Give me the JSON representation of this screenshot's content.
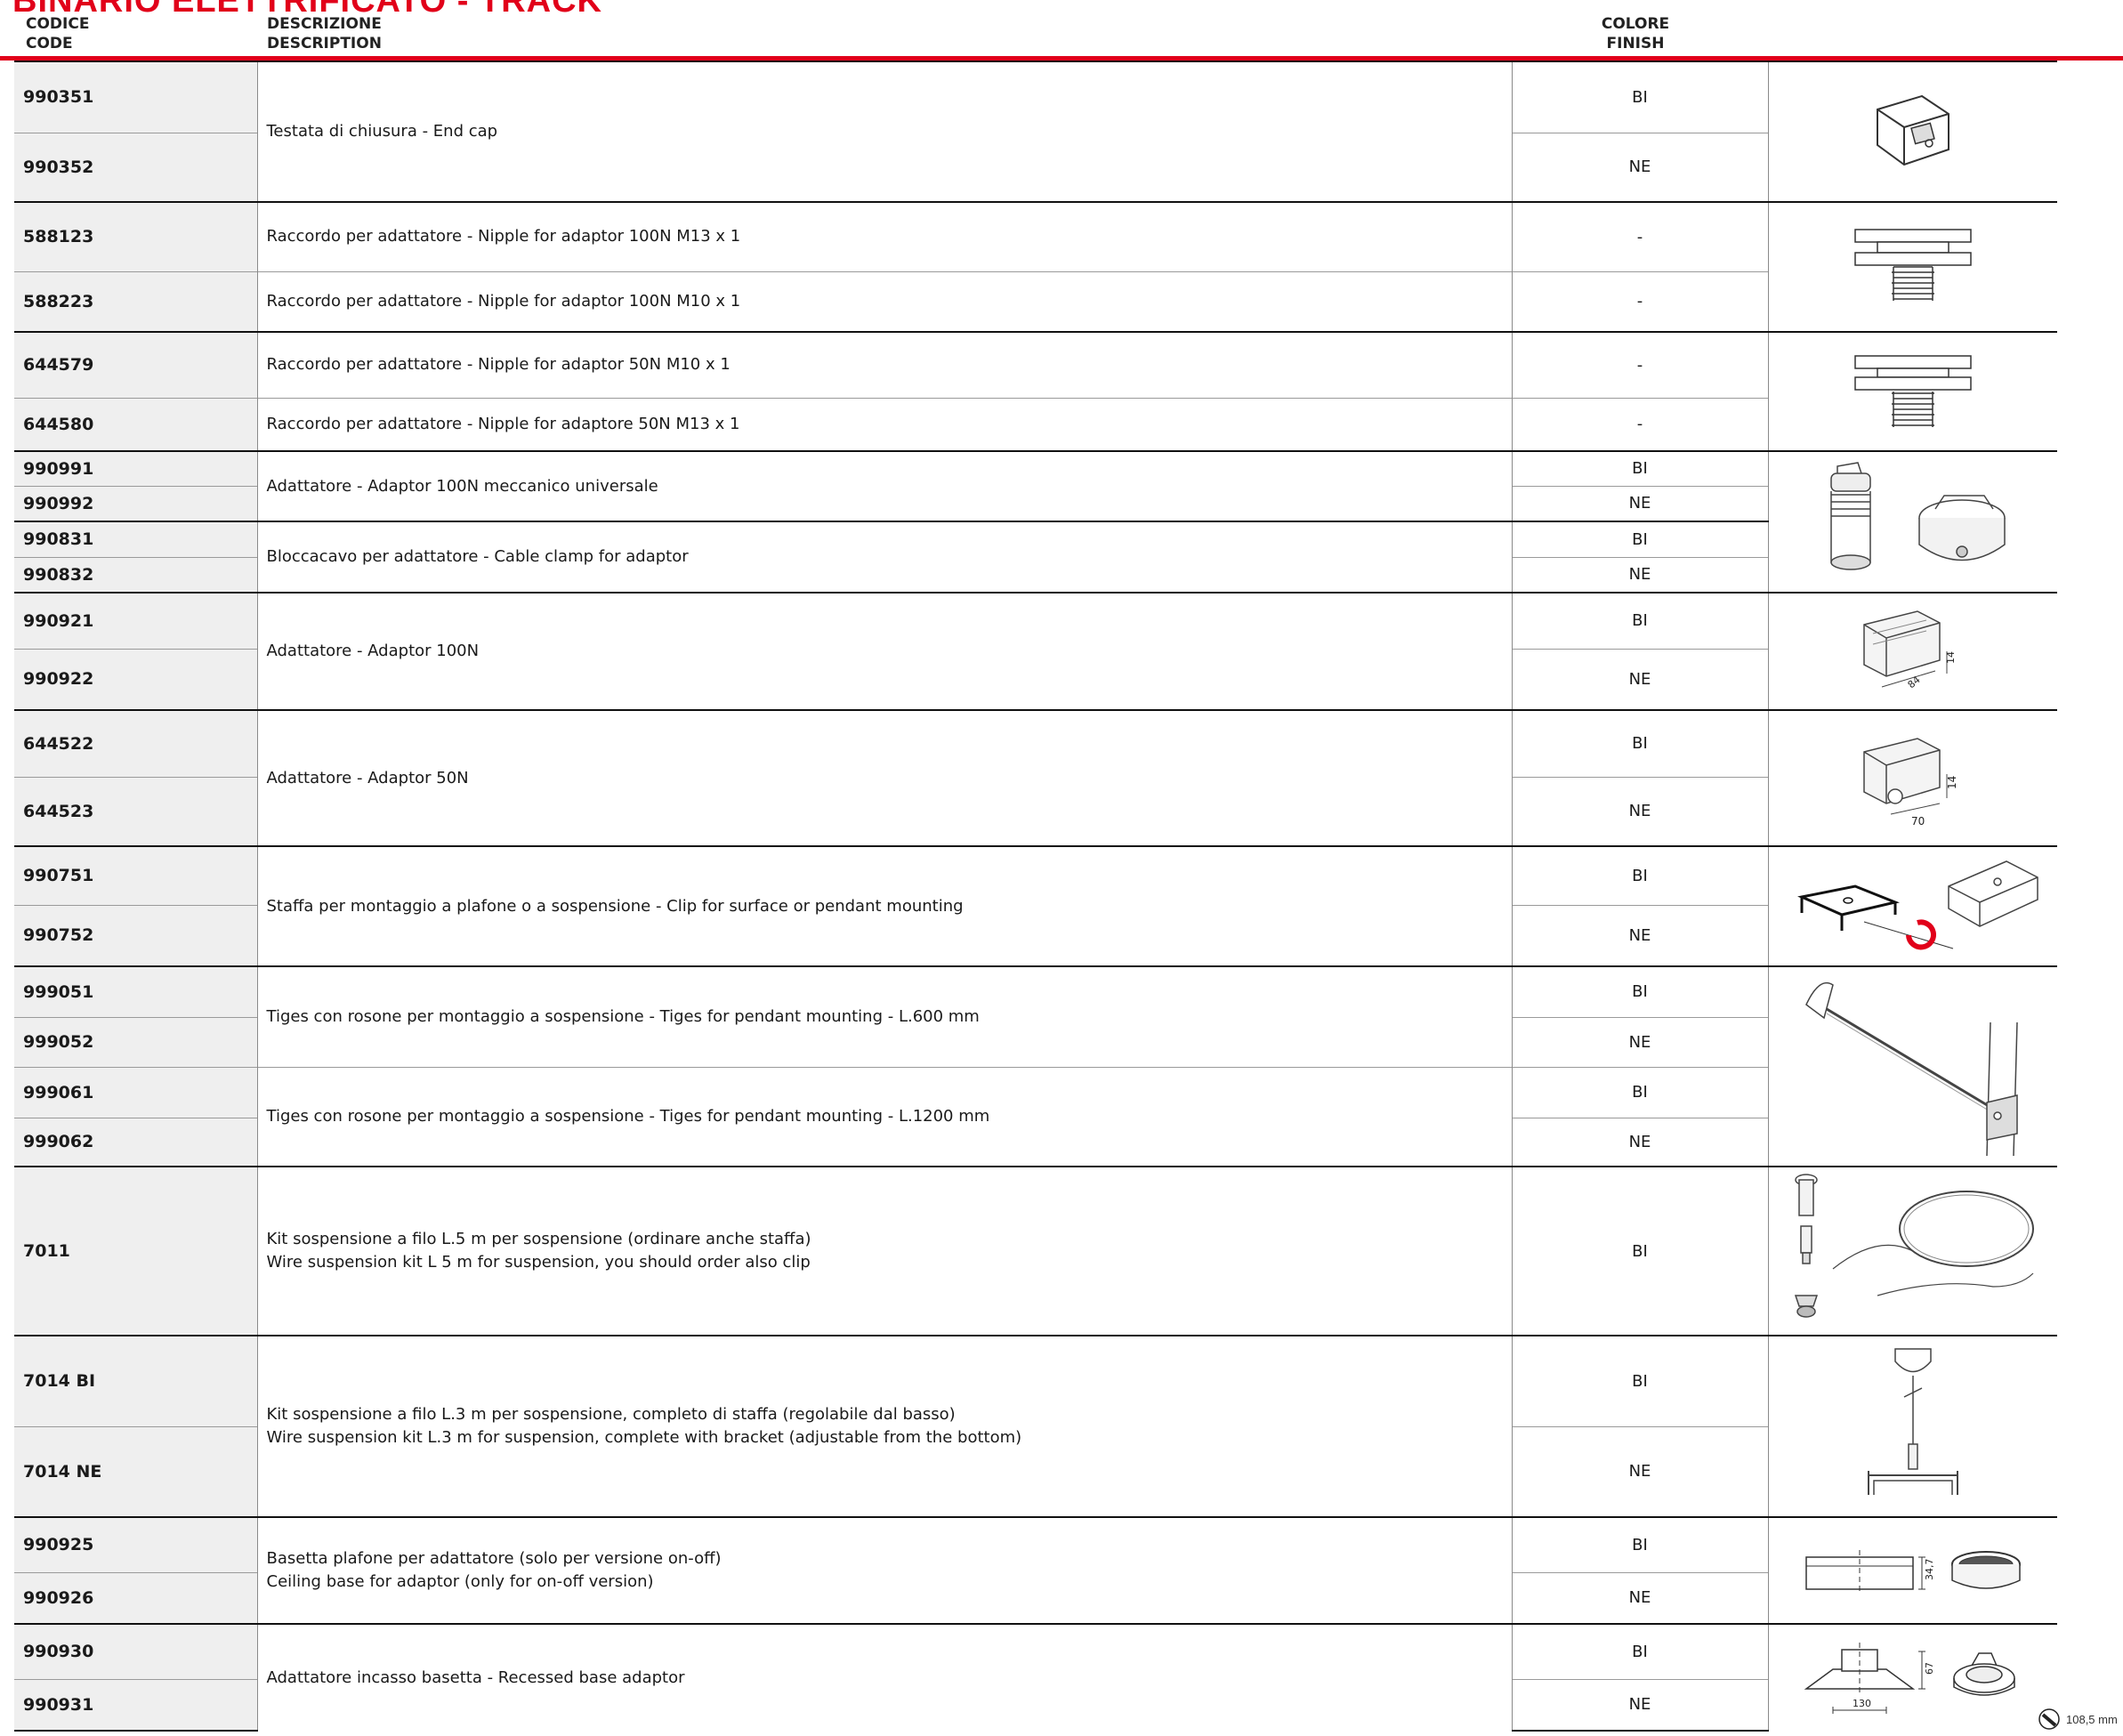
{
  "title": "BINARIO ELETTRIFICATO - TRACK",
  "header": {
    "code_it": "CODICE",
    "code_en": "CODE",
    "desc_it": "DESCRIZIONE",
    "desc_en": "DESCRIPTION",
    "finish_it": "COLORE",
    "finish_en": "FINISH"
  },
  "rows": [
    {
      "code": "990351",
      "finish": "BI",
      "desc": "Testata di chiusura - End cap",
      "image": "end-cap"
    },
    {
      "code": "990352",
      "finish": "NE"
    },
    {
      "code": "588123",
      "finish": "-",
      "desc": "Raccordo per adattatore - Nipple for adaptor 100N M13 x 1",
      "image": "nipple-100n"
    },
    {
      "code": "588223",
      "finish": "-",
      "desc": "Raccordo per adattatore - Nipple for adaptor 100N M10 x 1"
    },
    {
      "code": "644579",
      "finish": "-",
      "desc": "Raccordo per adattatore - Nipple for adaptor 50N M10 x 1",
      "image": "nipple-50n"
    },
    {
      "code": "644580",
      "finish": "-",
      "desc": "Raccordo per adattatore - Nipple for adaptore 50N M13 x 1"
    },
    {
      "code": "990991",
      "finish": "BI",
      "desc": "Adattatore - Adaptor 100N meccanico universale",
      "image": "mechanical-adaptor"
    },
    {
      "code": "990992",
      "finish": "NE"
    },
    {
      "code": "990831",
      "finish": "BI",
      "desc": "Bloccacavo per adattatore - Cable clamp for adaptor"
    },
    {
      "code": "990832",
      "finish": "NE"
    },
    {
      "code": "990921",
      "finish": "BI",
      "desc": "Adattatore - Adaptor 100N",
      "image": "adaptor-100n",
      "dims": [
        "84",
        "14"
      ]
    },
    {
      "code": "990922",
      "finish": "NE"
    },
    {
      "code": "644522",
      "finish": "BI",
      "desc": "Adattatore - Adaptor 50N",
      "image": "adaptor-50n",
      "dims": [
        "70",
        "14"
      ]
    },
    {
      "code": "644523",
      "finish": "NE"
    },
    {
      "code": "990751",
      "finish": "BI",
      "desc": "Staffa per montaggio a plafone o a sospensione - Clip for surface or pendant mounting",
      "image": "mounting-clip"
    },
    {
      "code": "990752",
      "finish": "NE"
    },
    {
      "code": "999051",
      "finish": "BI",
      "desc": "Tiges con rosone per montaggio a sospensione - Tiges for pendant mounting - L.600 mm",
      "image": "pendant-tige"
    },
    {
      "code": "999052",
      "finish": "NE"
    },
    {
      "code": "999061",
      "finish": "BI",
      "desc": "Tiges con rosone per montaggio a sospensione - Tiges for pendant mounting - L.1200 mm"
    },
    {
      "code": "999062",
      "finish": "NE"
    },
    {
      "code": "7011",
      "finish": "BI",
      "desc": "Kit sospensione a filo L.5 m per sospensione (ordinare anche staffa)",
      "desc2": "Wire suspension kit L 5 m for suspension, you should order also clip",
      "image": "wire-kit-5m"
    },
    {
      "code": "7014 BI",
      "finish": "BI",
      "desc": "Kit sospensione a filo L.3 m per sospensione, completo di staffa (regolabile dal basso)",
      "desc2": "Wire suspension kit L.3 m for suspension, complete with bracket (adjustable from the bottom)",
      "image": "wire-kit-3m"
    },
    {
      "code": "7014 NE",
      "finish": "NE"
    },
    {
      "code": "990925",
      "finish": "BI",
      "desc": "Basetta plafone per adattatore (solo per versione on-off)",
      "desc2": "Ceiling base for adaptor (only for on-off version)",
      "image": "ceiling-base",
      "dims": [
        "34,7"
      ]
    },
    {
      "code": "990926",
      "finish": "NE"
    },
    {
      "code": "990930",
      "finish": "BI",
      "desc": "Adattatore  incasso basetta - Recessed base adaptor",
      "image": "recessed-base",
      "dims": [
        "67",
        "130"
      ]
    },
    {
      "code": "990931",
      "finish": "NE"
    }
  ],
  "footnote": {
    "cutout": "108,5 mm"
  }
}
